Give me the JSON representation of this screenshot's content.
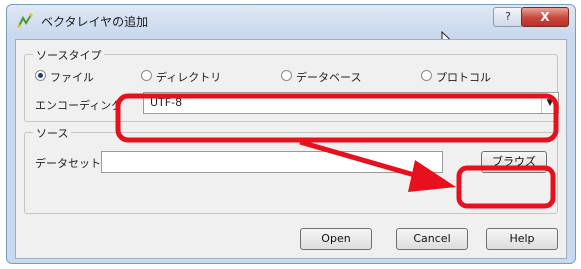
{
  "window": {
    "title": "ベクタレイヤの追加",
    "help_glyph": "?",
    "close_glyph": "X"
  },
  "source_type": {
    "group_label": "ソースタイプ",
    "options": [
      {
        "label": "ファイル",
        "selected": true
      },
      {
        "label": "ディレクトリ",
        "selected": false
      },
      {
        "label": "データベース",
        "selected": false
      },
      {
        "label": "プロトコル",
        "selected": false
      }
    ],
    "encoding_label": "エンコーディング",
    "encoding_value": "UTF-8"
  },
  "source": {
    "group_label": "ソース",
    "dataset_label": "データセット",
    "dataset_value": "",
    "browse_label": "ブラウズ"
  },
  "footer": {
    "open_label": "Open",
    "cancel_label": "Cancel",
    "help_label": "Help"
  },
  "annotation": {
    "color": "#e8101c"
  }
}
